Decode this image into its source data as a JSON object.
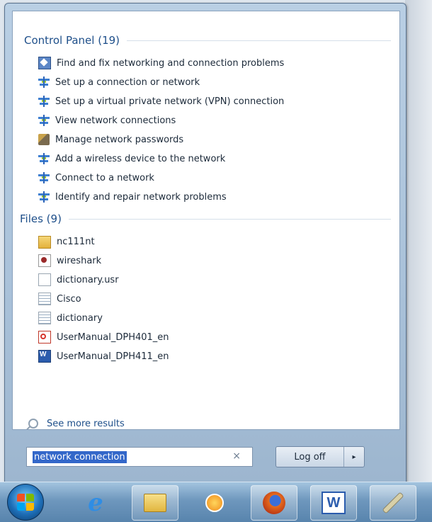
{
  "control_panel": {
    "header": "Control Panel (19)",
    "items": [
      {
        "label": "Find and fix networking and connection problems",
        "icon": "troubleshoot-icon"
      },
      {
        "label": "Set up a connection or network",
        "icon": "network-icon"
      },
      {
        "label": "Set up a virtual private network (VPN) connection",
        "icon": "network-icon"
      },
      {
        "label": "View network connections",
        "icon": "network-icon"
      },
      {
        "label": "Manage network passwords",
        "icon": "credentials-icon"
      },
      {
        "label": "Add a wireless device to the network",
        "icon": "network-icon"
      },
      {
        "label": "Connect to a network",
        "icon": "network-icon"
      },
      {
        "label": "Identify and repair network problems",
        "icon": "network-icon"
      }
    ]
  },
  "files": {
    "header": "Files (9)",
    "items": [
      {
        "label": "nc111nt",
        "icon": "folder-icon"
      },
      {
        "label": "wireshark",
        "icon": "wireshark-file-icon"
      },
      {
        "label": "dictionary.usr",
        "icon": "blank-file-icon"
      },
      {
        "label": "Cisco",
        "icon": "text-file-icon"
      },
      {
        "label": "dictionary",
        "icon": "text-file-icon"
      },
      {
        "label": "UserManual_DPH401_en",
        "icon": "pdf-icon"
      },
      {
        "label": "UserManual_DPH411_en",
        "icon": "word-doc-icon"
      }
    ]
  },
  "see_more": "See more results",
  "search": {
    "value": "network connection",
    "clear": "×"
  },
  "power": {
    "label": "Log off",
    "arrow": "▸"
  },
  "taskbar": {
    "items": [
      "start-button",
      "internet-explorer",
      "windows-explorer",
      "media-player",
      "firefox",
      "microsoft-word",
      "tool-app"
    ],
    "word_letter": "W"
  }
}
